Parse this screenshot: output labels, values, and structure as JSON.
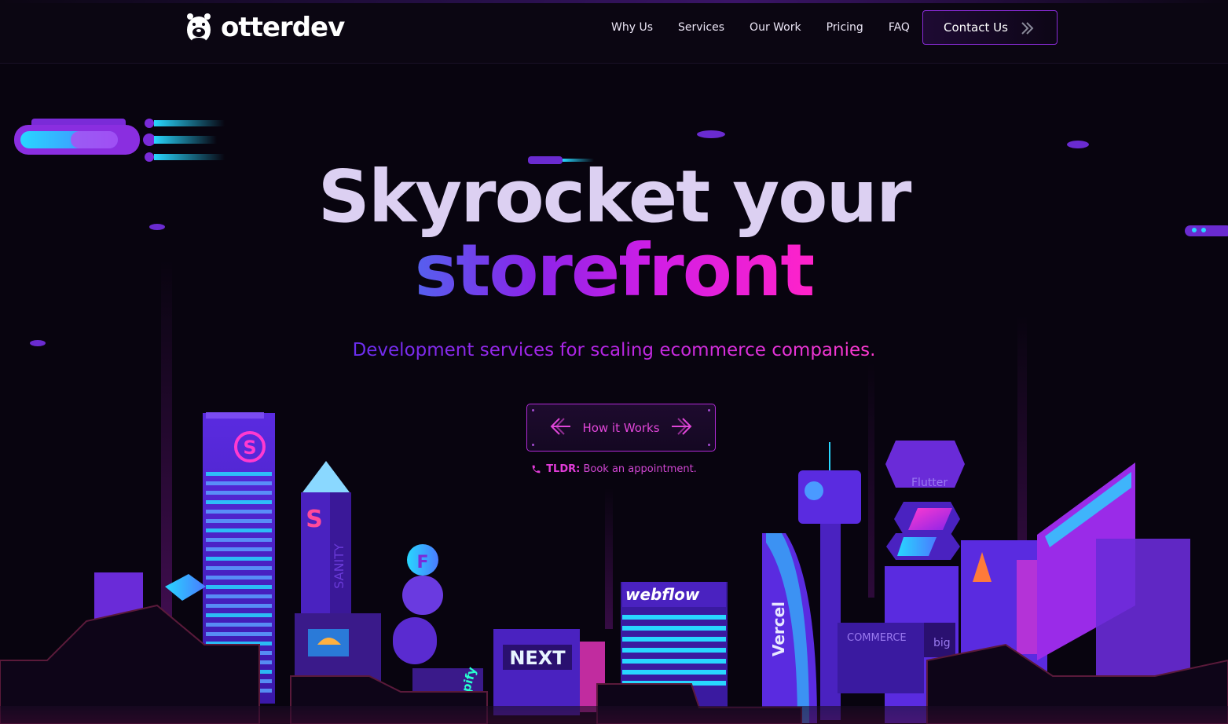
{
  "brand": {
    "name": "otterdev",
    "logo_icon": "otter-icon"
  },
  "nav": {
    "items": [
      {
        "label": "Why Us"
      },
      {
        "label": "Services"
      },
      {
        "label": "Our Work"
      },
      {
        "label": "Pricing"
      },
      {
        "label": "FAQ"
      }
    ],
    "cta": {
      "label": "Contact Us",
      "icon": "double-chevron-right-icon"
    }
  },
  "hero": {
    "title_line1": "Skyrocket your",
    "title_line2": "storefront",
    "subtitle": "Development services for scaling ecommerce companies.",
    "button": {
      "label": "How it Works",
      "left_icon": "arrow-left-icon",
      "right_icon": "arrow-right-icon"
    },
    "tldr": {
      "prefix": "TLDR:",
      "text": "Book an appointment.",
      "icon": "phone-icon"
    }
  },
  "city_logos": [
    "S",
    "S",
    "SANITY",
    "webflow",
    "NEXT",
    "shopify",
    "Vercel",
    "Flutter",
    "COMMERCE",
    "big"
  ],
  "colors": {
    "background": "#08040f",
    "accent_purple": "#8a2bd8",
    "accent_pink": "#e046d8",
    "accent_cyan": "#28d7ff"
  }
}
